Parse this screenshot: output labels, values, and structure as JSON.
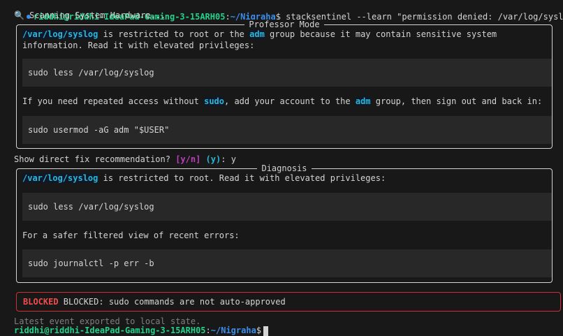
{
  "prompt": {
    "user_host": "riddhi@riddhi-IdeaPad-Gaming-3-15ARH05",
    "sep": ":",
    "path": "~/Nigraha",
    "dollar": "$",
    "command": " stacksentinel --learn \"permission denied: /var/log/syslog\""
  },
  "scanning": "🔍 Scanning System Hardware...",
  "professor": {
    "title": "Professor Mode",
    "p1_path": "/var/log/syslog",
    "p1_a": " is restricted to root or the ",
    "p1_adm": "adm",
    "p1_b": " group because it may contain sensitive system information. Read it with elevated privileges:",
    "code1": "sudo less /var/log/syslog",
    "p2_a": "If you need repeated access without ",
    "p2_sudo": "sudo",
    "p2_b": ", add your account to the ",
    "p2_adm": "adm",
    "p2_c": " group, then sign out and back in:",
    "code2": "sudo usermod -aG adm \"$USER\""
  },
  "question": {
    "text": "Show direct fix recommendation? ",
    "options": "[y/n]",
    "default": "(y)",
    "colon": ":",
    "answer": " y"
  },
  "diagnosis": {
    "title": "Diagnosis",
    "p1_path": "/var/log/syslog",
    "p1_a": " is restricted to root. Read it with elevated privileges:",
    "code1": "sudo less /var/log/syslog",
    "p2": "For a safer filtered view of recent errors:",
    "code2": "sudo journalctl -p err -b"
  },
  "alert": {
    "tag": "BLOCKED",
    "message": " BLOCKED: sudo commands are not auto-approved"
  },
  "exported": "Latest event exported to local state.",
  "prompt2": {
    "user_host": "riddhi@riddhi-IdeaPad-Gaming-3-15ARH05",
    "sep": ":",
    "path": "~/Nigraha",
    "dollar": "$"
  },
  "colors": {
    "background": "#181818",
    "prompt_user": "#23d18b",
    "prompt_path": "#3b8eea",
    "highlight": "#29b8db",
    "blocked": "#f14c4c",
    "options": "#bc3fbc"
  }
}
